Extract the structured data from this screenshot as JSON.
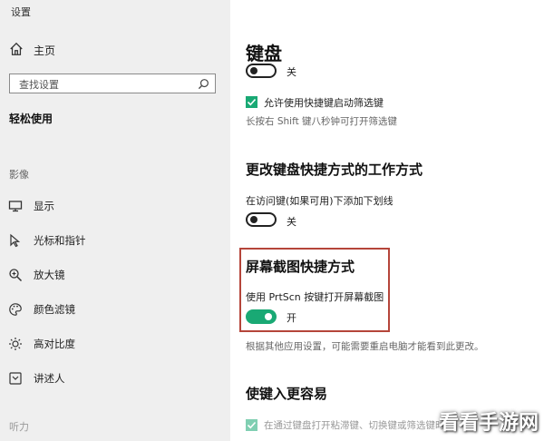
{
  "sidebar": {
    "app_title": "设置",
    "home_label": "主页",
    "search_placeholder": "查找设置",
    "section_heading": "轻松使用",
    "vision_group": "影像",
    "items": [
      {
        "label": "显示",
        "icon": "monitor-icon"
      },
      {
        "label": "光标和指针",
        "icon": "cursor-icon"
      },
      {
        "label": "放大镜",
        "icon": "magnifier-icon"
      },
      {
        "label": "颜色滤镜",
        "icon": "palette-icon"
      },
      {
        "label": "高对比度",
        "icon": "brightness-icon"
      },
      {
        "label": "讲述人",
        "icon": "narrator-icon"
      }
    ],
    "hearing_group": "听力"
  },
  "main": {
    "title": "键盘",
    "sticky_toggle": {
      "state_label": "关",
      "on": false
    },
    "filter_checkbox": {
      "label": "允许使用快捷键启动筛选键",
      "checked": true
    },
    "filter_hint": "长按右 Shift 键八秒钟可打开筛选键",
    "shortcut_section": {
      "heading": "更改键盘快捷方式的工作方式",
      "underline_label": "在访问键(如果可用)下添加下划线",
      "toggle_state": "关",
      "on": false
    },
    "printscreen_section": {
      "heading": "屏幕截图快捷方式",
      "label": "使用 PrtScn 按键打开屏幕截图",
      "toggle_state": "开",
      "on": true
    },
    "restart_note": "根据其他应用设置，可能需要重启电脑才能看到此更改。",
    "easier_section": {
      "heading": "使键入更容易",
      "checkbox_label": "在通过键盘打开粘滞键、切换键或筛选键时",
      "checked": true
    }
  },
  "watermark": "看看手游网",
  "colors": {
    "accent_green": "#19a974",
    "highlight_red": "#b5453a",
    "sidebar_bg": "#efefef"
  }
}
